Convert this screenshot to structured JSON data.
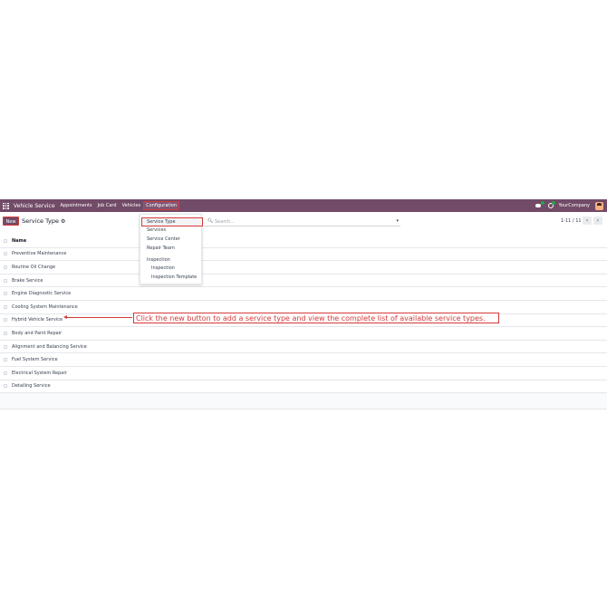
{
  "navbar": {
    "brand": "Vehicle Service",
    "menu": [
      "Appointments",
      "Job Card",
      "Vehicles",
      "Configuration"
    ],
    "company": "YourCompany",
    "color": "#714b67"
  },
  "control": {
    "new_label": "New",
    "breadcrumb": "Service Type",
    "search_placeholder": "Search...",
    "pager": "1-11 / 11"
  },
  "list": {
    "header": "Name",
    "rows": [
      "Preventive Maintenance",
      "Routine Oil Change",
      "Brake Service",
      "Engine Diagnostic Service",
      "Cooling System Maintenance",
      "Hybrid Vehicle Service",
      "Body and Paint Repair",
      "Alignment and Balancing Service",
      "Fuel System Service",
      "Electrical System Repair",
      "Detailing Service"
    ]
  },
  "dropdown": {
    "items": [
      "Service Type",
      "Services",
      "Service Center",
      "Repair Team"
    ],
    "section": "Inspection",
    "subitems": [
      "Inspection",
      "Inspection Template"
    ]
  },
  "annotation": {
    "text": "Click the new button to add a service type and view the complete list of available service types.",
    "color": "#d43a3a"
  }
}
